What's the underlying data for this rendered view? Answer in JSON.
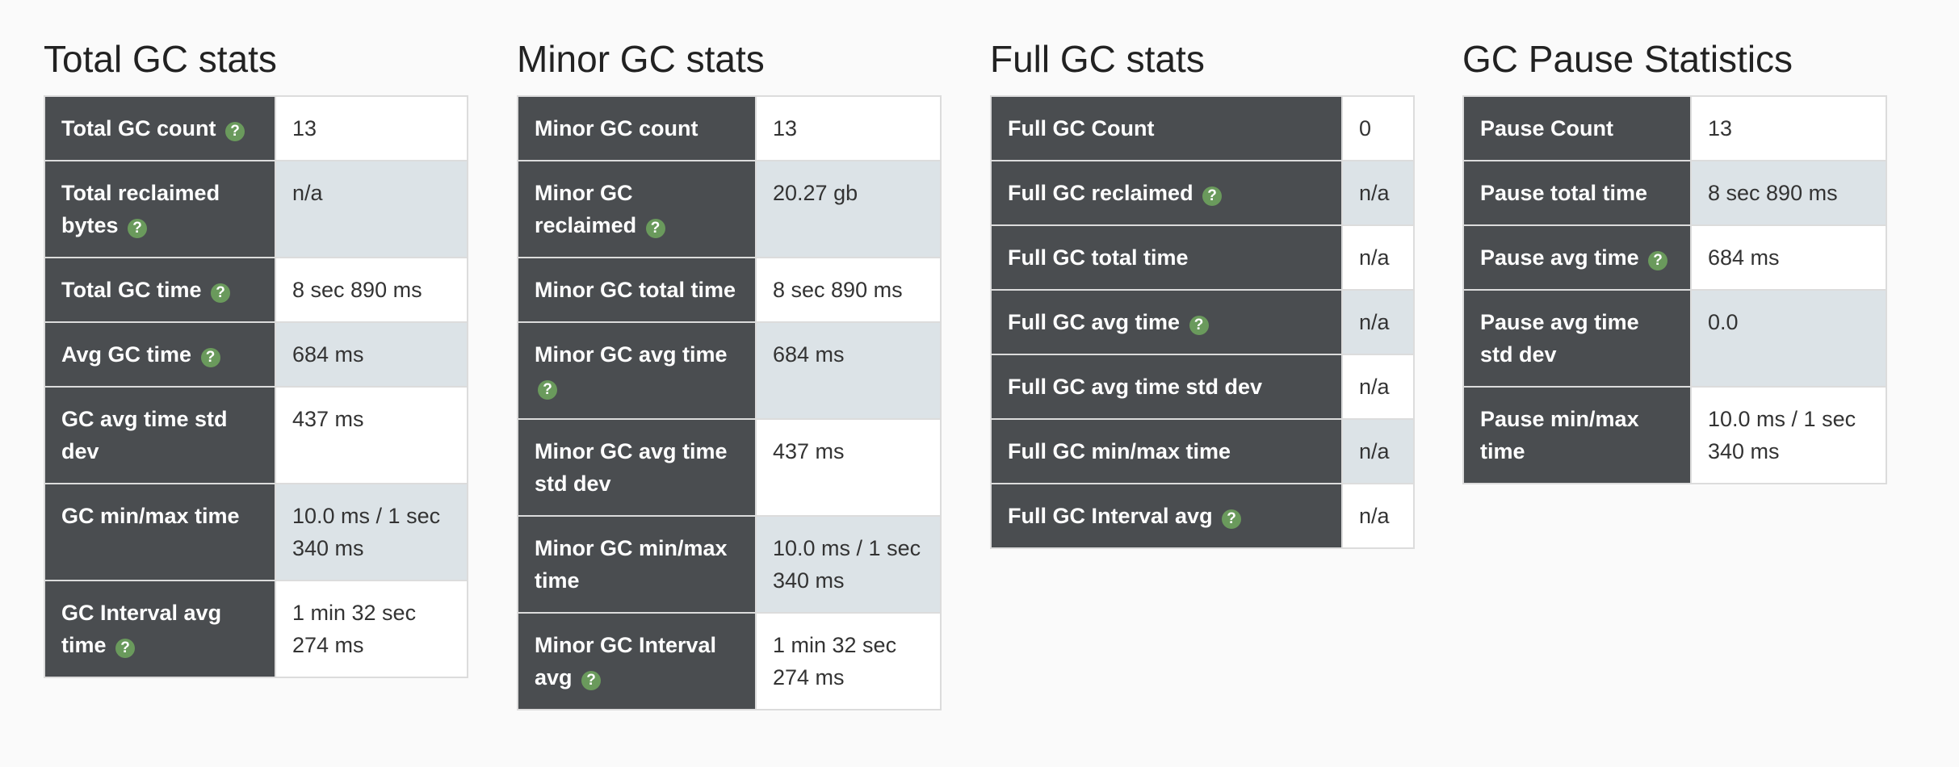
{
  "sections": [
    {
      "title": "Total GC stats",
      "rows": [
        {
          "label": "Total GC count",
          "help": true,
          "value": "13"
        },
        {
          "label": "Total reclaimed bytes",
          "help": true,
          "value": "n/a"
        },
        {
          "label": "Total GC time",
          "help": true,
          "value": "8 sec 890 ms"
        },
        {
          "label": "Avg GC time",
          "help": true,
          "value": "684 ms"
        },
        {
          "label": "GC avg time std dev",
          "help": false,
          "value": "437 ms"
        },
        {
          "label": "GC min/max time",
          "help": false,
          "value": "10.0 ms / 1 sec 340 ms"
        },
        {
          "label": "GC Interval avg time",
          "help": true,
          "value": "1 min 32 sec 274 ms"
        }
      ]
    },
    {
      "title": "Minor GC stats",
      "rows": [
        {
          "label": "Minor GC count",
          "help": false,
          "value": "13"
        },
        {
          "label": "Minor GC reclaimed",
          "help": true,
          "value": "20.27 gb"
        },
        {
          "label": "Minor GC total time",
          "help": false,
          "value": "8 sec 890 ms"
        },
        {
          "label": "Minor GC avg time",
          "help": true,
          "value": "684 ms"
        },
        {
          "label": "Minor GC avg time std dev",
          "help": false,
          "value": "437 ms"
        },
        {
          "label": "Minor GC min/max time",
          "help": false,
          "value": "10.0 ms / 1 sec 340 ms"
        },
        {
          "label": "Minor GC Interval avg",
          "help": true,
          "value": "1 min 32 sec 274 ms"
        }
      ]
    },
    {
      "title": "Full GC stats",
      "rows": [
        {
          "label": "Full GC Count",
          "help": false,
          "value": "0"
        },
        {
          "label": "Full GC reclaimed",
          "help": true,
          "value": "n/a"
        },
        {
          "label": "Full GC total time",
          "help": false,
          "value": "n/a"
        },
        {
          "label": "Full GC avg time",
          "help": true,
          "value": "n/a"
        },
        {
          "label": "Full GC avg time std dev",
          "help": false,
          "value": "n/a"
        },
        {
          "label": "Full GC min/max time",
          "help": false,
          "value": "n/a"
        },
        {
          "label": "Full GC Interval avg",
          "help": true,
          "value": "n/a"
        }
      ]
    },
    {
      "title": "GC Pause Statistics",
      "rows": [
        {
          "label": "Pause Count",
          "help": false,
          "value": "13"
        },
        {
          "label": "Pause total time",
          "help": false,
          "value": "8 sec 890 ms"
        },
        {
          "label": "Pause avg time",
          "help": true,
          "value": "684 ms"
        },
        {
          "label": "Pause avg time std dev",
          "help": false,
          "value": "0.0"
        },
        {
          "label": "Pause min/max time",
          "help": false,
          "value": "10.0 ms / 1 sec 340 ms"
        }
      ]
    }
  ],
  "help_glyph": "?",
  "help_icon": "question-circle-icon",
  "colors": {
    "label_bg": "#4a4d50",
    "value_bg": "#ffffff",
    "value_alt_bg": "#dce3e7",
    "help_icon": "#6a9a5c",
    "border": "#dcdcdc"
  }
}
